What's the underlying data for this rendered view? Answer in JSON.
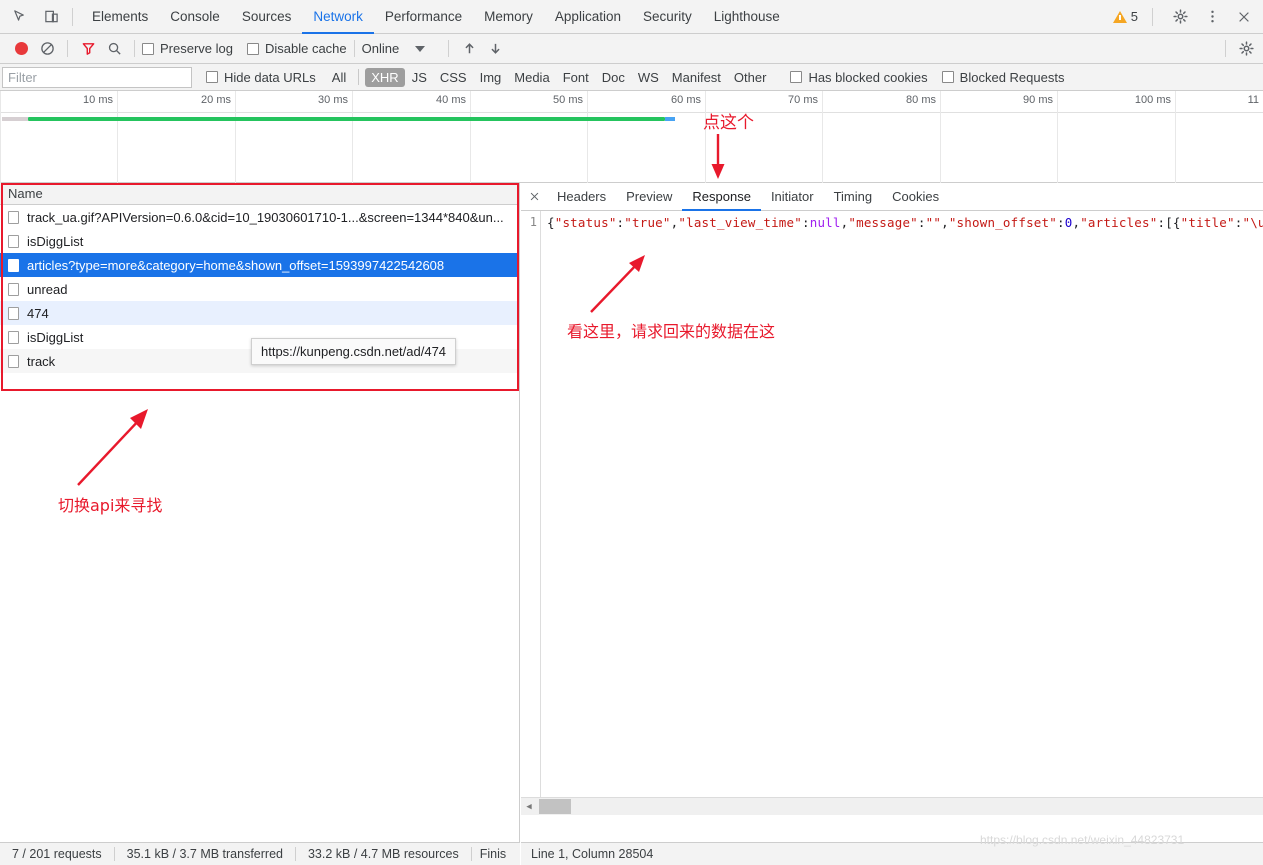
{
  "devtools": {
    "panels": [
      {
        "label": "Elements",
        "active": false
      },
      {
        "label": "Console",
        "active": false
      },
      {
        "label": "Sources",
        "active": false
      },
      {
        "label": "Network",
        "active": true
      },
      {
        "label": "Performance",
        "active": false
      },
      {
        "label": "Memory",
        "active": false
      },
      {
        "label": "Application",
        "active": false
      },
      {
        "label": "Security",
        "active": false
      },
      {
        "label": "Lighthouse",
        "active": false
      }
    ],
    "warning_count": "5",
    "icons": {
      "inspect": "inspect-element-icon",
      "device": "device-toolbar-icon",
      "settings": "gear-icon",
      "more": "kebab-menu-icon",
      "close": "close-icon",
      "warning": "warning-icon"
    }
  },
  "controls": {
    "record_title": "record-button",
    "clear_title": "clear-button",
    "filter_title": "filter-button",
    "search_title": "search-button",
    "preserve_log": "Preserve log",
    "disable_cache": "Disable cache",
    "throttling": "Online",
    "import_title": "import-har-button",
    "export_title": "export-har-button"
  },
  "filters": {
    "placeholder": "Filter",
    "value": "",
    "hide_data_urls": "Hide data URLs",
    "types": [
      {
        "label": "All",
        "selected": false
      },
      {
        "label": "XHR",
        "selected": true
      },
      {
        "label": "JS",
        "selected": false
      },
      {
        "label": "CSS",
        "selected": false
      },
      {
        "label": "Img",
        "selected": false
      },
      {
        "label": "Media",
        "selected": false
      },
      {
        "label": "Font",
        "selected": false
      },
      {
        "label": "Doc",
        "selected": false
      },
      {
        "label": "WS",
        "selected": false
      },
      {
        "label": "Manifest",
        "selected": false
      },
      {
        "label": "Other",
        "selected": false
      }
    ],
    "has_blocked_cookies": "Has blocked cookies",
    "blocked_requests": "Blocked Requests"
  },
  "timeline": {
    "ticks": [
      "10 ms",
      "20 ms",
      "30 ms",
      "40 ms",
      "50 ms",
      "60 ms",
      "70 ms",
      "80 ms",
      "90 ms",
      "100 ms",
      "11"
    ],
    "bar_color": "#25c45e"
  },
  "requests": {
    "column_header": "Name",
    "rows": [
      {
        "name": "track_ua.gif?APIVersion=0.6.0&cid=10_19030601710-1...&screen=1344*840&un...",
        "state": "plain"
      },
      {
        "name": "isDiggList",
        "state": "plain"
      },
      {
        "name": "articles?type=more&category=home&shown_offset=1593997422542608",
        "state": "selected"
      },
      {
        "name": "unread",
        "state": "plain"
      },
      {
        "name": "474",
        "state": "hover"
      },
      {
        "name": "isDiggList",
        "state": "plain"
      },
      {
        "name": "track",
        "state": "alt"
      }
    ],
    "tooltip": "https://kunpeng.csdn.net/ad/474"
  },
  "detail": {
    "tabs": [
      {
        "label": "Headers",
        "active": false
      },
      {
        "label": "Preview",
        "active": false
      },
      {
        "label": "Response",
        "active": true
      },
      {
        "label": "Initiator",
        "active": false
      },
      {
        "label": "Timing",
        "active": false
      },
      {
        "label": "Cookies",
        "active": false
      }
    ],
    "line_number": "1",
    "response_tokens": [
      {
        "t": "{",
        "c": "j-pun"
      },
      {
        "t": "\"status\"",
        "c": "j-key"
      },
      {
        "t": ":",
        "c": "j-pun"
      },
      {
        "t": "\"true\"",
        "c": "j-str"
      },
      {
        "t": ",",
        "c": "j-pun"
      },
      {
        "t": "\"last_view_time\"",
        "c": "j-key"
      },
      {
        "t": ":",
        "c": "j-pun"
      },
      {
        "t": "null",
        "c": "j-null"
      },
      {
        "t": ",",
        "c": "j-pun"
      },
      {
        "t": "\"message\"",
        "c": "j-key"
      },
      {
        "t": ":",
        "c": "j-pun"
      },
      {
        "t": "\"\"",
        "c": "j-str"
      },
      {
        "t": ",",
        "c": "j-pun"
      },
      {
        "t": "\"shown_offset\"",
        "c": "j-key"
      },
      {
        "t": ":",
        "c": "j-pun"
      },
      {
        "t": "0",
        "c": "j-num"
      },
      {
        "t": ",",
        "c": "j-pun"
      },
      {
        "t": "\"articles\"",
        "c": "j-key"
      },
      {
        "t": ":[{",
        "c": "j-pun"
      },
      {
        "t": "\"title\"",
        "c": "j-key"
      },
      {
        "t": ":",
        "c": "j-pun"
      },
      {
        "t": "\"\\u",
        "c": "j-str"
      }
    ]
  },
  "status": {
    "requests": "7 / 201 requests",
    "transferred": "35.1 kB / 3.7 MB transferred",
    "resources": "33.2 kB / 4.7 MB resources",
    "finish": "Finis",
    "cursor": "Line 1, Column 28504"
  },
  "annotations": {
    "click_this": "点这个",
    "look_here": "看这里，请求回来的数据在这",
    "switch_api": "切换api来寻找",
    "color": "#e8192c"
  },
  "watermark": "https://blog.csdn.net/weixin_44823731"
}
